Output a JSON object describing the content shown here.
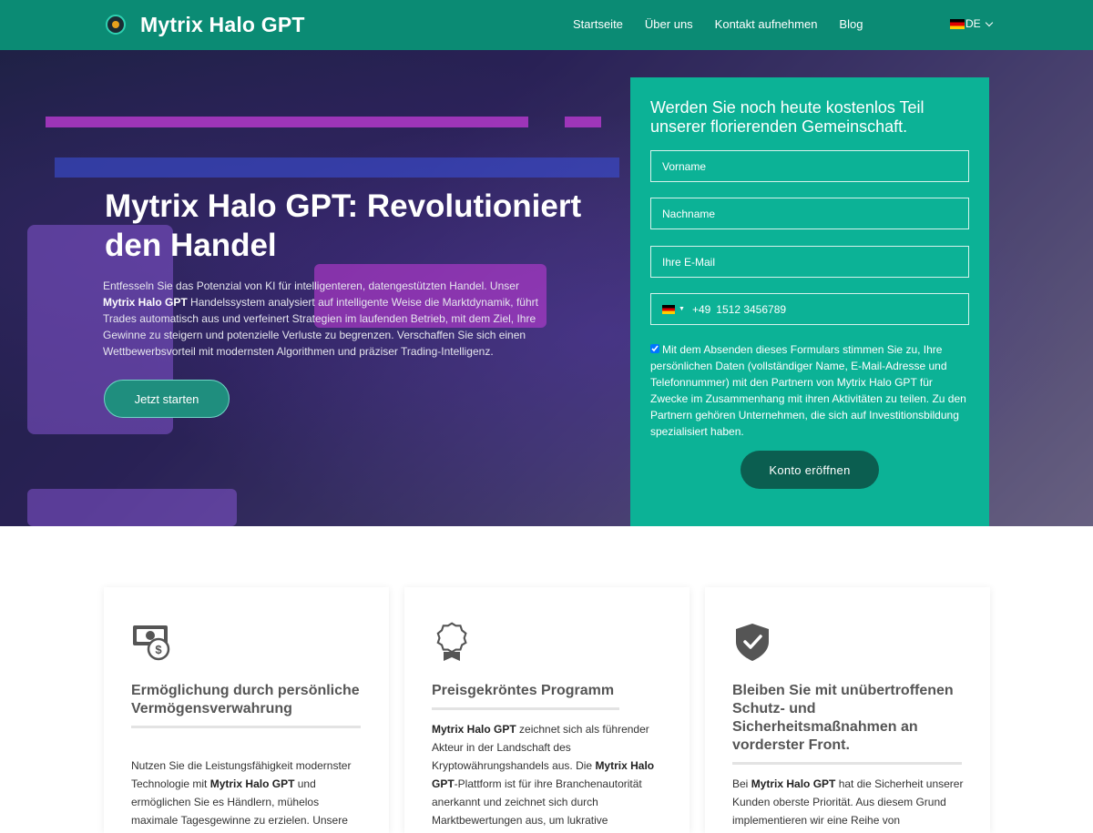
{
  "nav": {
    "brand": "Mytrix Halo GPT",
    "items": [
      "Startseite",
      "Über uns",
      "Kontakt aufnehmen",
      "Blog"
    ],
    "language": "DE"
  },
  "hero": {
    "title": "Mytrix Halo GPT: Revolutioniert den Handel",
    "text_pre": "Entfesseln Sie das Potenzial von KI für intelligenteren, datengestützten Handel. Unser ",
    "text_brand": "Mytrix Halo GPT",
    "text_post": " Handelssystem analysiert auf intelligente Weise die Marktdynamik, führt Trades automatisch aus und verfeinert Strategien im laufenden Betrieb, mit dem Ziel, Ihre Gewinne zu steigern und potenzielle Verluste zu begrenzen. Verschaffen Sie sich einen Wettbewerbsvorteil mit modernsten Algorithmen und präziser Trading-Intelligenz.",
    "cta": "Jetzt starten"
  },
  "form": {
    "title": "Werden Sie noch heute kostenlos Teil unserer florierenden Gemeinschaft.",
    "first_name_placeholder": "Vorname",
    "last_name_placeholder": "Nachname",
    "email_placeholder": "Ihre E-Mail",
    "phone_code": "+49",
    "phone_placeholder": "1512 3456789",
    "consent": "Mit dem Absenden dieses Formulars stimmen Sie zu, Ihre persönlichen Daten (vollständiger Name, E-Mail-Adresse und Telefonnummer) mit den Partnern von Mytrix Halo GPT für Zwecke im Zusammenhang mit ihren Aktivitäten zu teilen. Zu den Partnern gehören Unternehmen, die sich auf Investitionsbildung spezialisiert haben.",
    "submit": "Konto eröffnen"
  },
  "features": [
    {
      "icon": "money-dollar-icon",
      "title": "Ermöglichung durch persönliche Vermögensverwahrung",
      "text_pre": "Nutzen Sie die Leistungsfähigkeit modernster Technologie mit ",
      "text_brand": "Mytrix Halo GPT",
      "text_post": " und ermöglichen Sie es Händlern, mühelos maximale Tagesgewinne zu erzielen. Unsere"
    },
    {
      "icon": "award-ribbon-icon",
      "title": "Preisgekröntes Programm",
      "text_brand": "Mytrix Halo GPT",
      "text_mid": " zeichnet sich als führender Akteur in der Landschaft des Kryptowährungshandels aus. Die ",
      "text_brand2": "Mytrix Halo GPT",
      "text_post": "-Plattform ist für ihre Branchenautorität anerkannt und zeichnet sich durch Marktbewertungen aus, um lukrative"
    },
    {
      "icon": "shield-check-icon",
      "title": "Bleiben Sie mit unübertroffenen Schutz- und Sicherheitsmaßnahmen an vorderster Front.",
      "text_pre": "Bei ",
      "text_brand": "Mytrix Halo GPT",
      "text_post": " hat die Sicherheit unserer Kunden oberste Priorität. Aus diesem Grund implementieren wir eine Reihe von"
    }
  ],
  "colors": {
    "nav_bg": "#0b8b74",
    "form_bg": "#0cb296",
    "cta_dark": "#0b5e50"
  }
}
